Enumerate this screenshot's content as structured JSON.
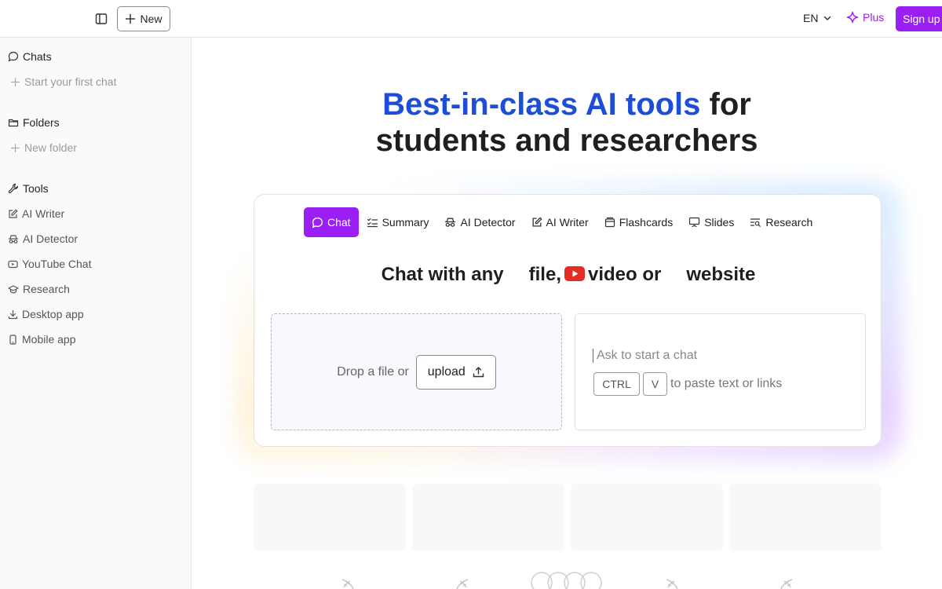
{
  "header": {
    "new_label": "New",
    "language": "EN",
    "plus_label": "Plus",
    "signup_label": "Sign up"
  },
  "sidebar": {
    "chats": {
      "title": "Chats",
      "action": "Start your first chat"
    },
    "folders": {
      "title": "Folders",
      "action": "New folder"
    },
    "tools": {
      "title": "Tools",
      "items": [
        {
          "label": "AI Writer",
          "icon": "pencil-square-icon"
        },
        {
          "label": "AI Detector",
          "icon": "detective-icon"
        },
        {
          "label": "YouTube Chat",
          "icon": "youtube-icon"
        },
        {
          "label": "Research",
          "icon": "graduation-cap-icon"
        },
        {
          "label": "Desktop app",
          "icon": "download-icon"
        },
        {
          "label": "Mobile app",
          "icon": "phone-icon"
        }
      ]
    }
  },
  "hero": {
    "highlight": "Best-in-class AI tools",
    "rest_line1": " for",
    "line2": "students and researchers"
  },
  "tool_tabs": [
    {
      "label": "Chat",
      "icon": "chat-bubble-icon",
      "active": true
    },
    {
      "label": "Summary",
      "icon": "checklist-icon",
      "active": false
    },
    {
      "label": "AI Detector",
      "icon": "detective-icon",
      "active": false
    },
    {
      "label": "AI Writer",
      "icon": "pencil-square-icon",
      "active": false
    },
    {
      "label": "Flashcards",
      "icon": "cards-icon",
      "active": false
    },
    {
      "label": "Slides",
      "icon": "presentation-icon",
      "active": false
    },
    {
      "label": "Research",
      "icon": "text-search-icon",
      "active": false
    }
  ],
  "card": {
    "headline_part1": "Chat with any",
    "headline_file": "file,",
    "headline_video": "video or",
    "headline_website": "website",
    "drop_text": "Drop a file or",
    "upload_label": "upload",
    "ask_placeholder": "Ask to start a chat",
    "key_ctrl": "CTRL",
    "key_v": "V",
    "paste_hint": "to paste text or links"
  },
  "colors": {
    "accent": "#9b1ef5",
    "hero_blue": "#1d4ed8",
    "youtube_red": "#e52d27"
  }
}
